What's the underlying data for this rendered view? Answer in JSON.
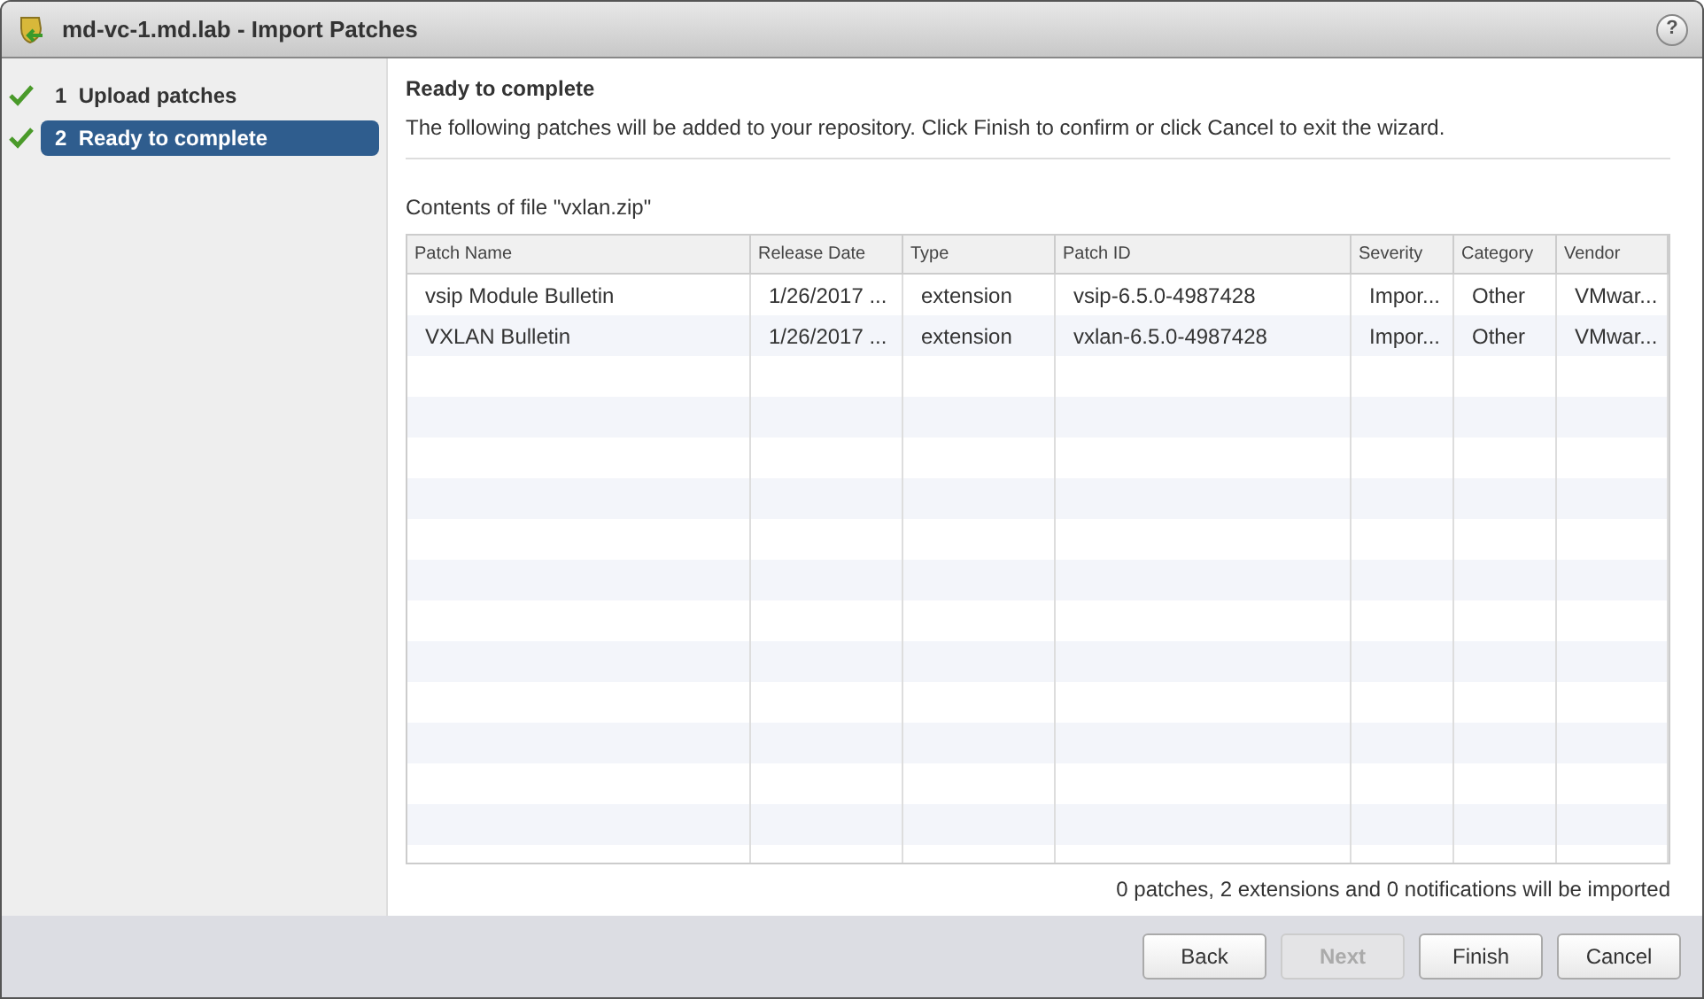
{
  "window": {
    "title": "md-vc-1.md.lab - Import Patches",
    "help_button": "?"
  },
  "steps": [
    {
      "number": "1",
      "label": "Upload patches",
      "completed": true,
      "selected": false
    },
    {
      "number": "2",
      "label": "Ready to complete",
      "completed": true,
      "selected": true
    }
  ],
  "page": {
    "heading": "Ready to complete",
    "description": "The following patches will be added to your repository. Click Finish to confirm or click Cancel to exit the wizard.",
    "contents_label": "Contents of file \"vxlan.zip\""
  },
  "table": {
    "columns": [
      "Patch Name",
      "Release Date",
      "Type",
      "Patch ID",
      "Severity",
      "Category",
      "Vendor"
    ],
    "rows": [
      [
        "vsip Module Bulletin",
        "1/26/2017 ...",
        "extension",
        "vsip-6.5.0-4987428",
        "Impor...",
        "Other",
        "VMwar..."
      ],
      [
        "VXLAN Bulletin",
        "1/26/2017 ...",
        "extension",
        "vxlan-6.5.0-4987428",
        "Impor...",
        "Other",
        "VMwar..."
      ]
    ]
  },
  "summary": "0 patches, 2 extensions and 0 notifications will be imported",
  "buttons": [
    {
      "label": "Back",
      "disabled": false
    },
    {
      "label": "Next",
      "disabled": true
    },
    {
      "label": "Finish",
      "disabled": false
    },
    {
      "label": "Cancel",
      "disabled": false
    }
  ]
}
